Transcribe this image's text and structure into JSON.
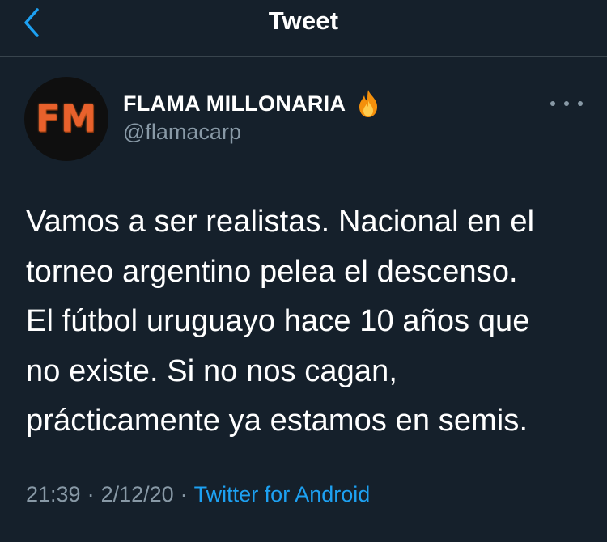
{
  "header": {
    "title": "Tweet",
    "back_icon": "chevron-left-icon",
    "accent_color": "#1da1f2"
  },
  "author": {
    "avatar_text": "FM",
    "display_name": "FLAMA MILLONARIA",
    "name_emoji_icon": "fire-icon",
    "handle": "@flamacarp"
  },
  "more_icon": "more-horizontal-icon",
  "tweet": {
    "lines": [
      "Vamos a ser realistas. Nacional en el",
      "torneo argentino pelea el descenso.",
      "El fútbol uruguayo hace 10 años que",
      "no existe. Si no nos cagan,",
      "prácticamente ya estamos en semis."
    ]
  },
  "meta": {
    "time": "21:39",
    "separator": "·",
    "date": "2/12/20",
    "source": "Twitter for Android"
  },
  "colors": {
    "background": "#15202b",
    "secondary_text": "#8899a6",
    "divider": "#38444d"
  }
}
